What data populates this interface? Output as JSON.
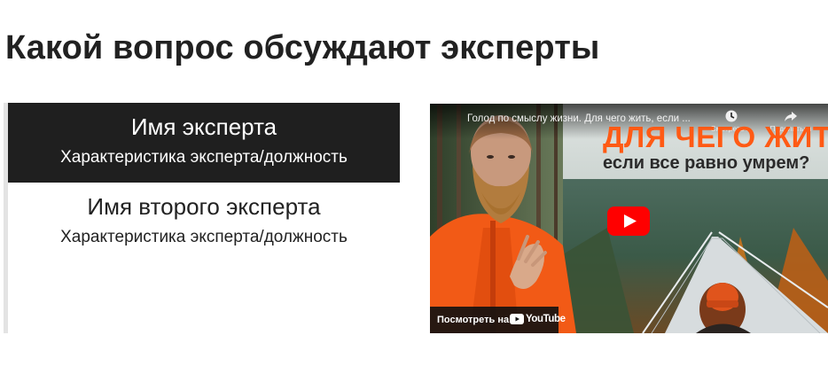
{
  "page": {
    "title": "Какой вопрос обсуждают эксперты"
  },
  "experts": [
    {
      "name": "Имя эксперта",
      "description": "Характеристика эксперта/должность",
      "active": true
    },
    {
      "name": "Имя второго эксперта",
      "description": "Характеристика эксперта/должность",
      "active": false
    }
  ],
  "video": {
    "title": "Голод по смыслу жизни. Для чего жить, если ...",
    "thumbnail_headline_line1": "ДЛЯ ЧЕГО ЖИТЬ,",
    "thumbnail_headline_line2": "если все равно умрем?",
    "watch_later_label": "Смотреть ...",
    "share_label": "Поделиться",
    "watch_on_label": "Посмотреть на",
    "platform_name": "YouTube",
    "icons": [
      "clock-icon",
      "share-icon",
      "play-icon",
      "youtube-logo-icon"
    ],
    "colors": {
      "headline": "#ff5a14",
      "play": "#ff0000",
      "active_expert_bg": "#1f1f1f"
    }
  }
}
